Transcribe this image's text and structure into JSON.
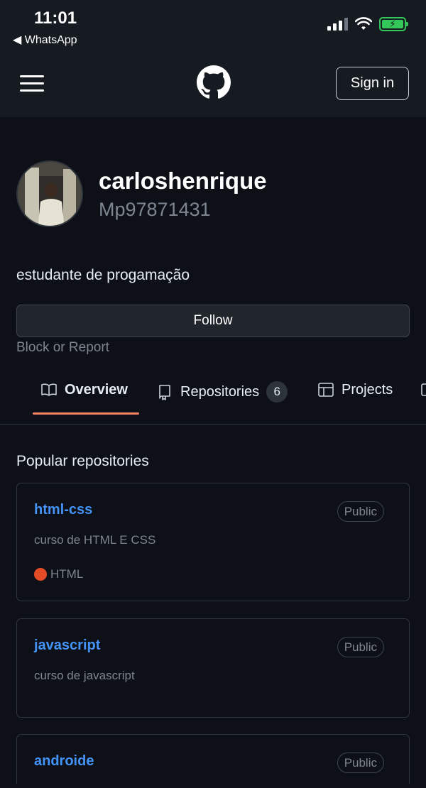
{
  "status_bar": {
    "time": "11:01",
    "back_label": "◀ WhatsApp",
    "battery_color": "#34c759"
  },
  "header": {
    "logo_icon": "github-icon",
    "sign_in_label": "Sign in"
  },
  "profile": {
    "name": "carloshenrique",
    "login": "Mp97871431",
    "bio": "estudante de progamação",
    "follow_label": "Follow",
    "block_label": "Block or Report"
  },
  "tabs": [
    {
      "label": "Overview",
      "icon": "book-icon",
      "selected": true
    },
    {
      "label": "Repositories",
      "icon": "repo-icon",
      "count": "6"
    },
    {
      "label": "Projects",
      "icon": "table-icon"
    }
  ],
  "popular": {
    "title": "Popular repositories",
    "repos": [
      {
        "name": "html-css",
        "visibility": "Public",
        "description": "curso de HTML E CSS",
        "language": "HTML",
        "language_color": "#e34c26"
      },
      {
        "name": "javascript",
        "visibility": "Public",
        "description": "curso de javascript"
      },
      {
        "name": "androide",
        "visibility": "Public"
      }
    ]
  },
  "colors": {
    "background": "#0d1117",
    "header": "#161b22",
    "link": "#4493f8",
    "tab_underline": "#f78166"
  }
}
